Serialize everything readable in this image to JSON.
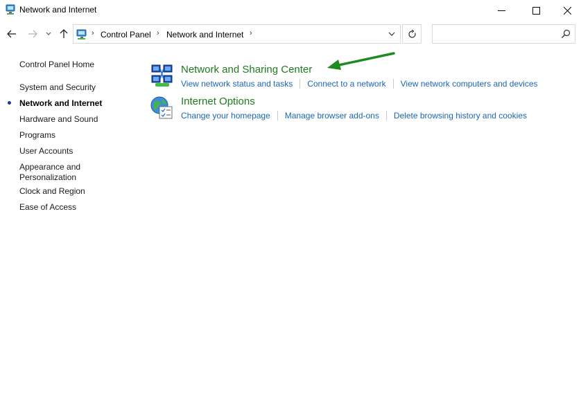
{
  "window": {
    "title": "Network and Internet"
  },
  "address": {
    "crumbs": [
      "Control Panel",
      "Network and Internet"
    ]
  },
  "search": {
    "placeholder": ""
  },
  "sidebar": {
    "home": "Control Panel Home",
    "items": [
      {
        "label": "System and Security"
      },
      {
        "label": "Network and Internet",
        "active": true
      },
      {
        "label": "Hardware and Sound"
      },
      {
        "label": "Programs"
      },
      {
        "label": "User Accounts"
      },
      {
        "label": "Appearance and",
        "label2": "Personalization"
      },
      {
        "label": "Clock and Region"
      },
      {
        "label": "Ease of Access"
      }
    ]
  },
  "categories": [
    {
      "title": "Network and Sharing Center",
      "icon": "network-sharing-icon",
      "links": [
        "View network status and tasks",
        "Connect to a network",
        "View network computers and devices"
      ]
    },
    {
      "title": "Internet Options",
      "icon": "internet-options-icon",
      "links": [
        "Change your homepage",
        "Manage browser add-ons",
        "Delete browsing history and cookies"
      ]
    }
  ],
  "colors": {
    "category_title": "#1e7a1e",
    "link": "#1a66b3",
    "annotation_arrow": "#1f8a1f",
    "active_bullet": "#1a3e8c"
  }
}
